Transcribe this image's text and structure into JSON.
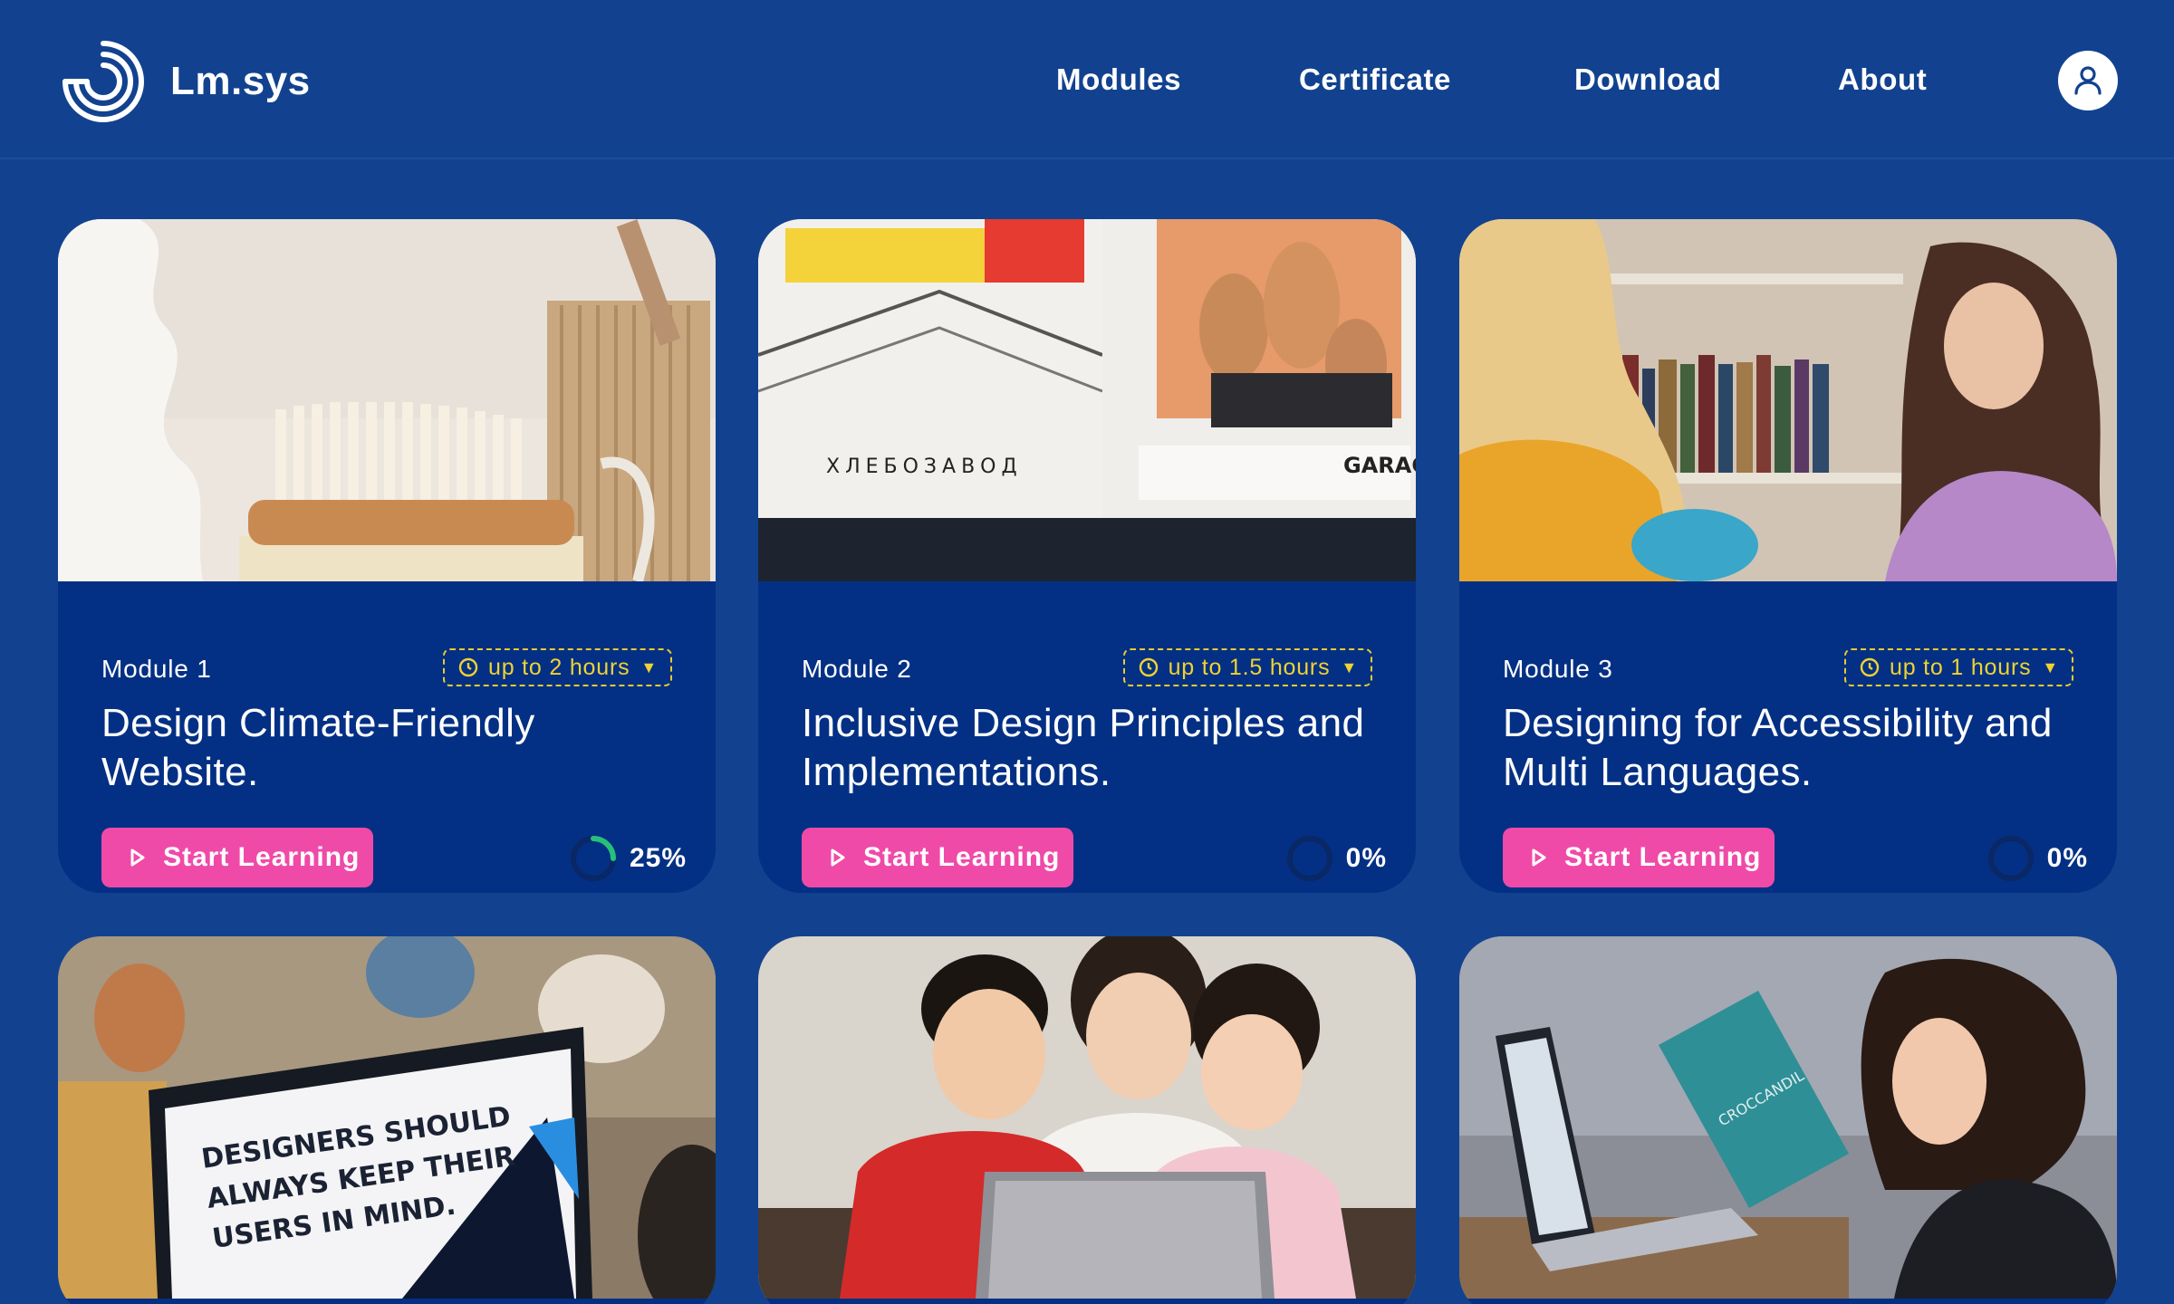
{
  "brand": {
    "name": "Lm.sys",
    "logo_icon": "concentric-rings-logo"
  },
  "nav": [
    {
      "label": "Modules"
    },
    {
      "label": "Certificate"
    },
    {
      "label": "Download"
    },
    {
      "label": "About"
    }
  ],
  "user": {
    "icon": "user-icon"
  },
  "colors": {
    "background": "#12428f",
    "card": "#033084",
    "accent_pink": "#f04aa8",
    "duration_yellow": "#f0d232",
    "progress_green": "#27c07a"
  },
  "modules": [
    {
      "label": "Module 1",
      "duration": "up to 2 hours",
      "title": "Design Climate-Friendly Website.",
      "button": "Start Learning",
      "progress_label": "25%",
      "progress": 0.25,
      "image": "wooden-brush-photo"
    },
    {
      "label": "Module 2",
      "duration": "up to 1.5 hours",
      "title": "Inclusive Design Principles and Implementations.",
      "button": "Start Learning",
      "progress_label": "0%",
      "progress": 0,
      "image": "street-posters-photo"
    },
    {
      "label": "Module 3",
      "duration": "up to 1 hours",
      "title": "Designing for Accessibility and Multi Languages.",
      "button": "Start Learning",
      "progress_label": "0%",
      "progress": 0,
      "image": "two-women-talking-photo"
    },
    {
      "image": "laptop-designers-slide-photo",
      "image_text": "DESIGNERS SHOULD ALWAYS KEEP THEIR USERS IN MIND."
    },
    {
      "image": "family-laptop-photo"
    },
    {
      "image": "girl-reading-photo",
      "image_text": "CROCCANDIL"
    }
  ]
}
